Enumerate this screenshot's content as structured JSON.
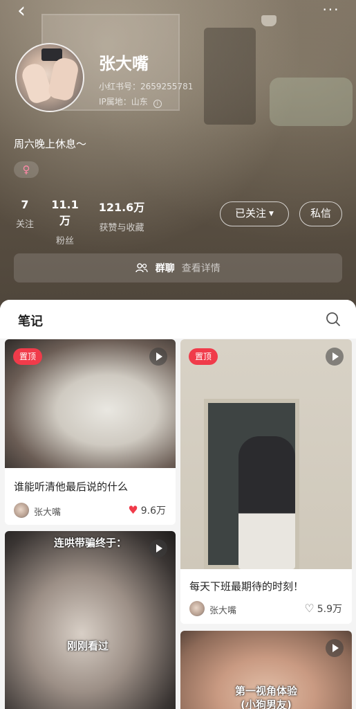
{
  "nav": {
    "back_glyph": "‹",
    "more_glyph": "···"
  },
  "profile": {
    "name": "张大嘴",
    "id_line": "小红书号：2659255781",
    "ip_line": "IP属地：山东",
    "bio": "周六晚上休息～",
    "gender_glyph": "♀"
  },
  "stats": [
    {
      "value": "7",
      "label": "关注"
    },
    {
      "value": "11.1万",
      "label": "粉丝"
    },
    {
      "value": "121.6万",
      "label": "获赞与收藏"
    }
  ],
  "actions": {
    "follow_label": "已关注",
    "message_label": "私信"
  },
  "group_chat": {
    "title": "群聊",
    "detail": "查看详情"
  },
  "tab": {
    "notes_label": "笔记"
  },
  "colors": {
    "accent_red": "#f03b4a",
    "header_bg": "#5b5043"
  },
  "cards": [
    {
      "badge": "置顶",
      "title": "谁能听清他最后说的什么",
      "author": "张大嘴",
      "likes": "9.6万",
      "liked": true
    },
    {
      "badge": "置顶",
      "title": "每天下班最期待的时刻！",
      "author": "张大嘴",
      "likes": "5.9万",
      "liked": false
    },
    {
      "overlay_top": "连哄带骗终于：",
      "overlay_mid": "刚刚看过"
    },
    {
      "overlay_line1": "第一视角体验",
      "overlay_line2": "(小狗男友)"
    }
  ]
}
